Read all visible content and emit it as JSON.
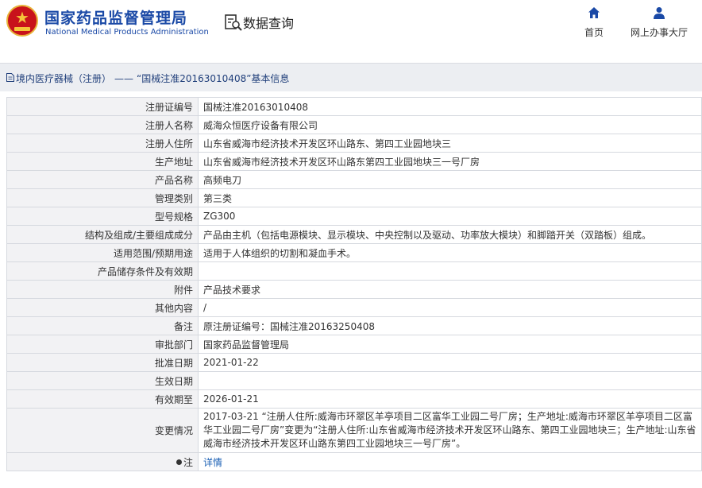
{
  "header": {
    "logo_cn": "国家药品监督管理局",
    "logo_en": "National Medical Products Administration",
    "logo_icon": "emblem-icon",
    "query_label": "数据查询",
    "query_icon": "data-search-icon",
    "nav": [
      {
        "label": "首页",
        "icon": "home-icon"
      },
      {
        "label": "网上办事大厅",
        "icon": "user-icon"
      }
    ]
  },
  "breadcrumb": {
    "icon": "document-icon",
    "category": "境内医疗器械（注册）",
    "separator": "——",
    "title": "“国械注准20163010408”基本信息"
  },
  "colors": {
    "brand_blue": "#1a49a6",
    "breadcrumb_bg": "#eceef2",
    "label_bg": "#f2f2f4",
    "link": "#1a5fb4"
  },
  "rows": [
    {
      "label": "注册证编号",
      "value": "国械注准20163010408"
    },
    {
      "label": "注册人名称",
      "value": "威海众恒医疗设备有限公司"
    },
    {
      "label": "注册人住所",
      "value": "山东省威海市经济技术开发区环山路东、第四工业园地块三"
    },
    {
      "label": "生产地址",
      "value": "山东省威海市经济技术开发区环山路东第四工业园地块三一号厂房"
    },
    {
      "label": "产品名称",
      "value": "高频电刀"
    },
    {
      "label": "管理类别",
      "value": "第三类"
    },
    {
      "label": "型号规格",
      "value": "ZG300"
    },
    {
      "label": "结构及组成/主要组成成分",
      "value": "产品由主机（包括电源模块、显示模块、中央控制以及驱动、功率放大模块）和脚踏开关（双踏板）组成。"
    },
    {
      "label": "适用范围/预期用途",
      "value": "适用于人体组织的切割和凝血手术。"
    },
    {
      "label": "产品储存条件及有效期",
      "value": ""
    },
    {
      "label": "附件",
      "value": "产品技术要求"
    },
    {
      "label": "其他内容",
      "value": "/"
    },
    {
      "label": "备注",
      "value": "原注册证编号：国械注准20163250408"
    },
    {
      "label": "审批部门",
      "value": "国家药品监督管理局"
    },
    {
      "label": "批准日期",
      "value": "2021-01-22"
    },
    {
      "label": "生效日期",
      "value": ""
    },
    {
      "label": "有效期至",
      "value": "2026-01-21"
    },
    {
      "label": "变更情况",
      "value": "2017-03-21 “注册人住所:威海市环翠区羊亭项目二区富华工业园二号厂房；生产地址:威海市环翠区羊亭项目二区富华工业园二号厂房”变更为“注册人住所:山东省威海市经济技术开发区环山路东、第四工业园地块三；生产地址:山东省威海市经济技术开发区环山路东第四工业园地块三一号厂房”。"
    },
    {
      "label": "注",
      "label_icon": "pin-icon",
      "value": "详情"
    }
  ]
}
